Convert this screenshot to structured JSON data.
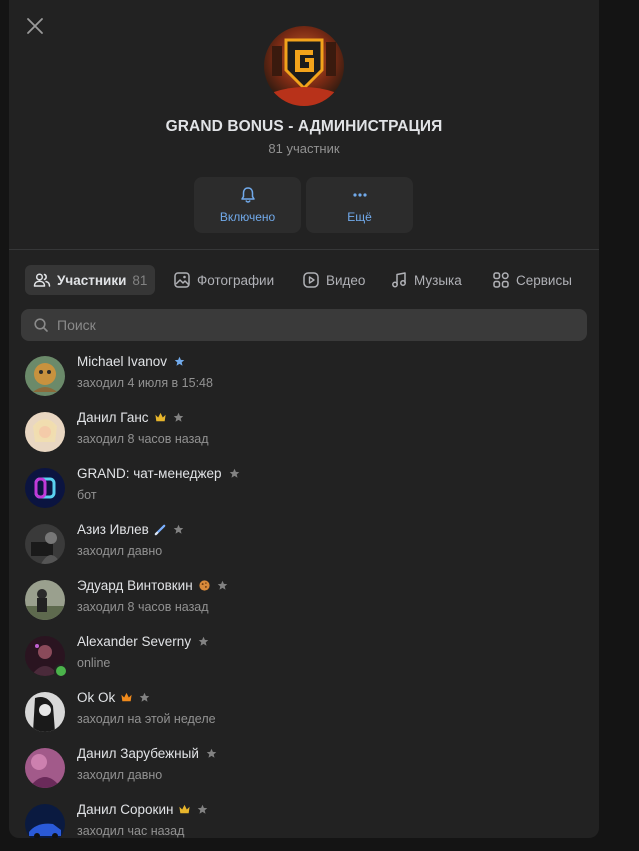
{
  "community": {
    "title": "GRAND BONUS - АДМИНИСТРАЦИЯ",
    "members_count_text": "81 участник"
  },
  "actions": {
    "notifications_label": "Включено",
    "more_label": "Ещё"
  },
  "tabs": [
    {
      "label": "Участники",
      "count": "81",
      "icon": "users-icon"
    },
    {
      "label": "Фотографии",
      "icon": "photo-icon"
    },
    {
      "label": "Видео",
      "icon": "video-icon"
    },
    {
      "label": "Музыка",
      "icon": "music-icon"
    },
    {
      "label": "Сервисы",
      "icon": "services-icon"
    }
  ],
  "search": {
    "placeholder": "Поиск",
    "value": ""
  },
  "members": [
    {
      "name": "Michael Ivanov",
      "status": "заходил 4 июля в 15:48",
      "badge": "blue-star-icon",
      "star_color": "#71aaeb"
    },
    {
      "name": "Данил Ганс",
      "status": "заходил 8 часов назад",
      "badge": "crown-icon",
      "star_color": "#828282"
    },
    {
      "name": "GRAND: чат-менеджер",
      "status": "бот",
      "badge": "",
      "star_color": "#828282"
    },
    {
      "name": "Азиз Ивлев",
      "status": "заходил давно",
      "badge": "pen-icon",
      "star_color": "#828282"
    },
    {
      "name": "Эдуард Винтовкин",
      "status": "заходил 8 часов назад",
      "badge": "cookie-icon",
      "star_color": "#828282"
    },
    {
      "name": "Alexander Severny",
      "status": "online",
      "badge": "",
      "star_color": "#828282",
      "online": true
    },
    {
      "name": "Ok Ok",
      "status": "заходил на этой неделе",
      "badge": "orange-crown-icon",
      "star_color": "#828282"
    },
    {
      "name": "Данил Зарубежный",
      "status": "заходил давно",
      "badge": "",
      "star_color": "#828282"
    },
    {
      "name": "Данил Сорокин",
      "status": "заходил час назад",
      "badge": "crown-icon",
      "star_color": "#828282"
    }
  ],
  "colors": {
    "background": "#141414",
    "panel": "#222222",
    "accent": "#71aaeb",
    "muted_text": "#929292",
    "online": "#4bb34b"
  }
}
